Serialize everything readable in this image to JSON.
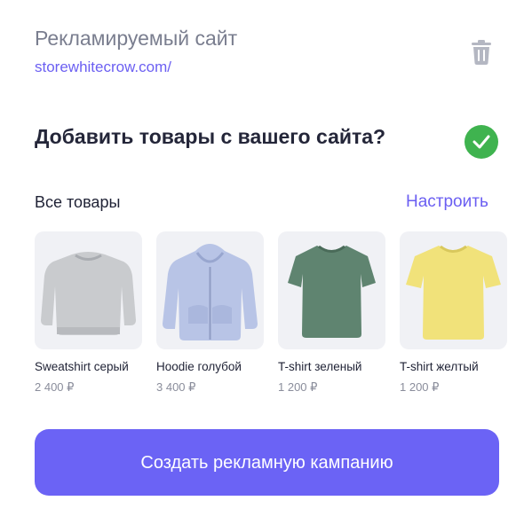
{
  "site": {
    "label": "Рекламируемый сайт",
    "url": "storewhitecrow.com/"
  },
  "question": {
    "text": "Добавить товары с вашего сайта?",
    "checked": true
  },
  "goods": {
    "title": "Все товары",
    "configure_label": "Настроить",
    "items": [
      {
        "name": "Sweatshirt серый",
        "price": "2 400 ₽",
        "kind": "sweatshirt",
        "color": "#c9cbce"
      },
      {
        "name": "Hoodie голубой",
        "price": "3 400 ₽",
        "kind": "hoodie",
        "color": "#b8c4e6"
      },
      {
        "name": "T-shirt зеленый",
        "price": "1 200 ₽",
        "kind": "tshirt",
        "color": "#5f8470"
      },
      {
        "name": "T-shirt желтый",
        "price": "1 200 ₽",
        "kind": "tshirt",
        "color": "#f1e27a"
      }
    ]
  },
  "cta": {
    "label": "Создать рекламную кампанию"
  },
  "colors": {
    "accent": "#6b5ff2",
    "button": "#6b63f5",
    "success": "#3fb34f",
    "muted": "#7a7e8f"
  }
}
